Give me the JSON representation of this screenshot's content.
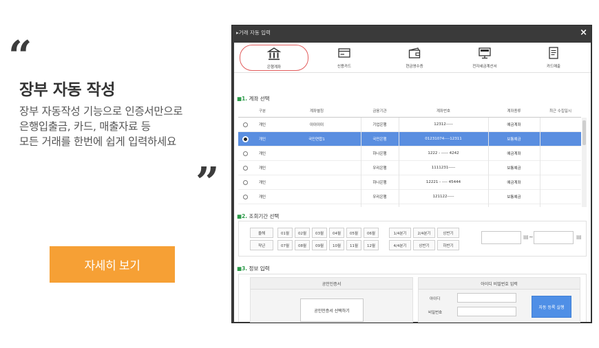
{
  "promo": {
    "quote_open": "“",
    "quote_close": "”",
    "title": "장부 자동 작성",
    "desc": [
      "장부 자동작성 기능으로 인증서만으로",
      "은행입출금, 카드, 매출자료 등",
      "모든 거래를 한번에 쉽게 입력하세요"
    ],
    "button": "자세히 보기",
    "accent": "#f6a035"
  },
  "window": {
    "title": "▸거래 자동 입력",
    "close": "×",
    "tabs": [
      {
        "label": "은행계좌",
        "icon": "bank-icon",
        "active": true
      },
      {
        "label": "신용카드",
        "icon": "credit-card-icon",
        "active": false
      },
      {
        "label": "현금영수증",
        "icon": "receipt-wallet-icon",
        "active": false
      },
      {
        "label": "전자세금계산서",
        "icon": "monitor-invoice-icon",
        "active": false
      },
      {
        "label": "카드매출",
        "icon": "document-icon",
        "active": false
      }
    ],
    "section1": {
      "num": "■1.",
      "title": "계좌 선택"
    },
    "accounts": {
      "headers": [
        "",
        "구분",
        "계좌별칭",
        "금융기관",
        "계좌번호",
        "계좌종류",
        "최근 수집일시"
      ],
      "rows": [
        {
          "type": "개인",
          "alias": "이이이이",
          "bank": "기업은행",
          "number": "12312-----",
          "kind": "예금계좌",
          "recent": "",
          "selected": false
        },
        {
          "type": "개인",
          "alias": "국민연합1",
          "bank": "국민은행",
          "number": "01231074----12311",
          "kind": "보통예금",
          "recent": "",
          "selected": true
        },
        {
          "type": "개인",
          "alias": "",
          "bank": "하나은행",
          "number": "1222 - ----- 4242",
          "kind": "예금계좌",
          "recent": "",
          "selected": false
        },
        {
          "type": "개인",
          "alias": "",
          "bank": "우리은행",
          "number": "1111231-----",
          "kind": "보통예금",
          "recent": "",
          "selected": false
        },
        {
          "type": "개인",
          "alias": "",
          "bank": "하나은행",
          "number": "12221 - ---- 45444",
          "kind": "예금계좌",
          "recent": "",
          "selected": false
        },
        {
          "type": "개인",
          "alias": "",
          "bank": "우리은행",
          "number": "121122-----",
          "kind": "보통예금",
          "recent": "",
          "selected": false
        }
      ]
    },
    "section2": {
      "num": "■2.",
      "title": "조회기간 선택"
    },
    "period": {
      "year_buttons": [
        "올해",
        "작년"
      ],
      "months_row1": [
        "01월",
        "02월",
        "03월",
        "04월",
        "05월",
        "06월"
      ],
      "months_row2": [
        "07월",
        "08월",
        "09월",
        "10월",
        "11월",
        "12월"
      ],
      "quarters_row1": [
        "1/4분기",
        "2/4분기",
        "상반기"
      ],
      "quarters_row2": [
        "4/4분기",
        "상반기",
        "하반기"
      ],
      "date_sep": "~",
      "calendar_icon": "calendar-icon"
    },
    "section3": {
      "num": "■3.",
      "title": "정보 입력"
    },
    "info": {
      "cert_header": "공인인증서",
      "cert_button": "공인인증서 선택하기",
      "login_header": "아이디 비밀번호 입력",
      "id_label": "아이디",
      "pw_label": "비밀번호",
      "run_button": "자동 등록 실행",
      "run_color": "#4f8fe6"
    },
    "selected_row_color": "#5a8ee0"
  }
}
